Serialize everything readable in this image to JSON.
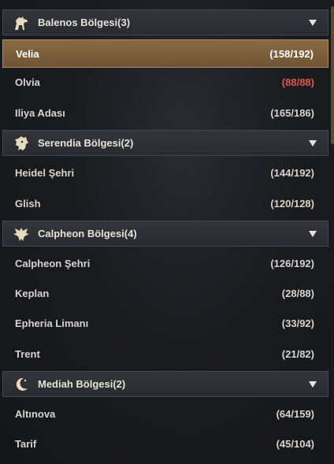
{
  "regions": [
    {
      "name": "Balenos Bölgesi(3)",
      "icon": "horse-icon",
      "nodes": [
        {
          "name": "Velia",
          "count": "(158/192)",
          "selected": true
        },
        {
          "name": "Olvia",
          "count": "(88/88)",
          "full": true
        },
        {
          "name": "Iliya Adası",
          "count": "(165/186)"
        }
      ]
    },
    {
      "name": "Serendia Bölgesi(2)",
      "icon": "lion-icon",
      "nodes": [
        {
          "name": "Heidel Şehri",
          "count": "(144/192)"
        },
        {
          "name": "Glish",
          "count": "(120/128)"
        }
      ]
    },
    {
      "name": "Calpheon Bölgesi(4)",
      "icon": "eagle-icon",
      "nodes": [
        {
          "name": "Calpheon Şehri",
          "count": "(126/192)"
        },
        {
          "name": "Keplan",
          "count": "(28/88)"
        },
        {
          "name": "Epheria Limanı",
          "count": "(33/92)"
        },
        {
          "name": "Trent",
          "count": "(21/82)"
        }
      ]
    },
    {
      "name": "Mediah Bölgesi(2)",
      "icon": "crescent-icon",
      "nodes": [
        {
          "name": "Altınova",
          "count": "(64/159)"
        },
        {
          "name": "Tarif",
          "count": "(45/104)"
        }
      ]
    }
  ],
  "colors": {
    "selected": "#8a6a44",
    "full": "#e0574c"
  }
}
